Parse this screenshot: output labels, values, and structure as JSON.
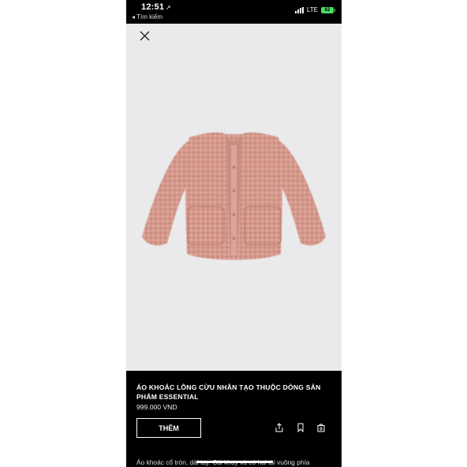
{
  "status_bar": {
    "time": "12:51",
    "location_glyph": "➚",
    "back_label": "◂ Tìm kiếm",
    "network": "LTE",
    "battery": "62"
  },
  "close_icon": "close-icon",
  "product": {
    "image_description_icon": "jacket-photo",
    "title": "ÁO KHOÁC LÔNG CỪU NHÂN TẠO THUỘC DÒNG SẢN PHẨM ESSENTIAL",
    "price": "999.000 VND",
    "add_button_label": "THÊM",
    "description": "Áo khoác cổ tròn, dài tay. Cài khuy và có hai túi vuông phía"
  },
  "actions": [
    "share-icon",
    "bookmark-icon",
    "bag-icon"
  ],
  "colors": {
    "panel": "#000000",
    "image_bg": "#eaeaec",
    "jacket": "#d69a8d"
  }
}
